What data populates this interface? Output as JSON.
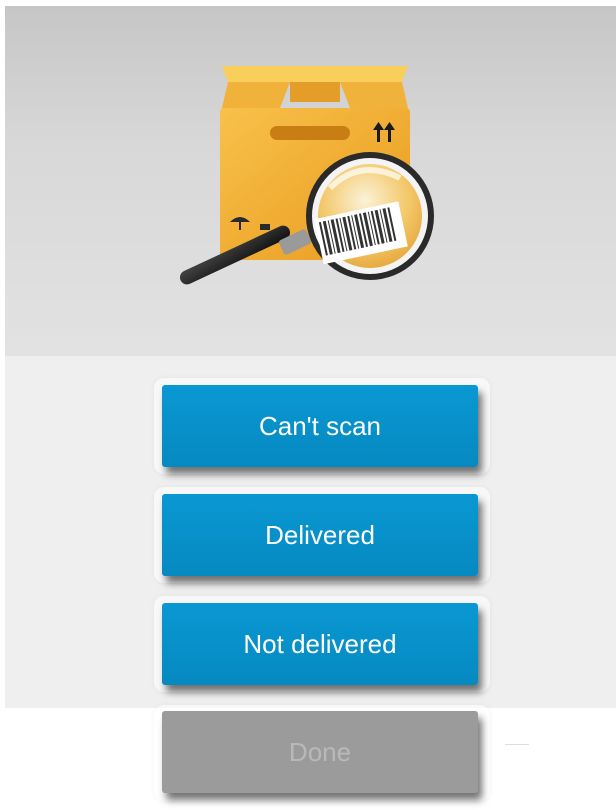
{
  "header": {
    "illustration_icon": "package-barcode-scan-icon"
  },
  "actions": [
    {
      "label": "Can't scan",
      "enabled": true
    },
    {
      "label": "Delivered",
      "enabled": true
    },
    {
      "label": "Not delivered",
      "enabled": true
    },
    {
      "label": "Done",
      "enabled": false
    }
  ],
  "colors": {
    "button_blue": "#0a98d2",
    "button_disabled": "#9b9b9b",
    "box_orange": "#f4ae2f"
  }
}
